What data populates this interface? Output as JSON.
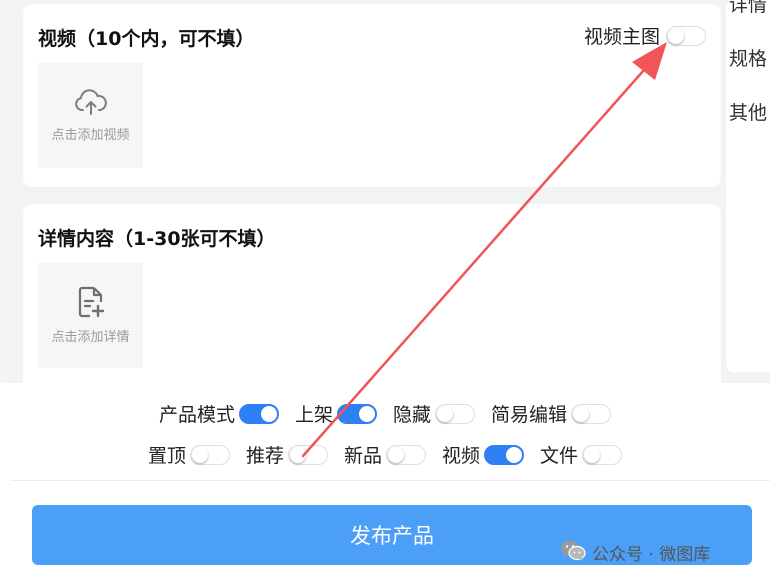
{
  "video_card": {
    "title": "视频（10个内，可不填）",
    "main_image_toggle_label": "视频主图",
    "main_image_toggle_on": false,
    "upload_label": "点击添加视频",
    "upload_icon": "cloud-upload-icon"
  },
  "detail_card": {
    "title": "详情内容（1-30张可不填）",
    "upload_label": "点击添加详情",
    "upload_icon": "file-add-icon"
  },
  "right_panel": {
    "labels": [
      "详情",
      "规格",
      "其他"
    ]
  },
  "toggles_row1": [
    {
      "label": "产品模式",
      "on": true
    },
    {
      "label": "上架",
      "on": true
    },
    {
      "label": "隐藏",
      "on": false
    },
    {
      "label": "简易编辑",
      "on": false
    }
  ],
  "toggles_row2": [
    {
      "label": "置顶",
      "on": false
    },
    {
      "label": "推荐",
      "on": false
    },
    {
      "label": "新品",
      "on": false
    },
    {
      "label": "视频",
      "on": true
    },
    {
      "label": "文件",
      "on": false
    }
  ],
  "publish_button_label": "发布产品",
  "watermark": "公众号 · 微图库",
  "colors": {
    "accent": "#2f7ff5",
    "publish_button": "#4b9ff7",
    "annotation_arrow": "#f0555a"
  }
}
